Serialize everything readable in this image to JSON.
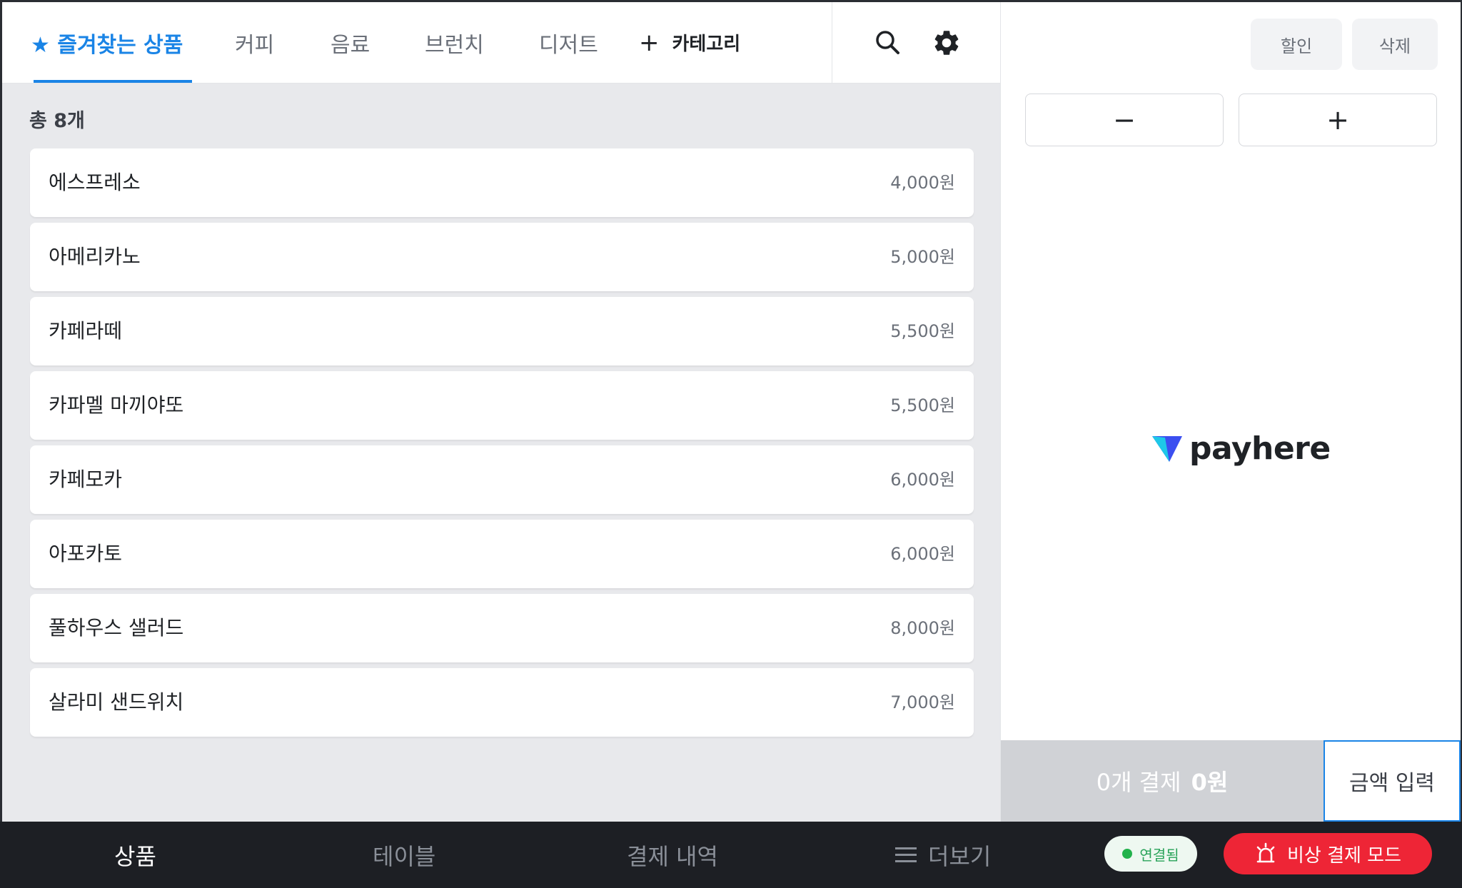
{
  "tabs": [
    {
      "label": "★ 즐겨찾는 상품",
      "active": true
    },
    {
      "label": "커피",
      "active": false
    },
    {
      "label": "음료",
      "active": false
    },
    {
      "label": "브런치",
      "active": false
    },
    {
      "label": "디저트",
      "active": false
    }
  ],
  "add_category": {
    "icon": "plus-icon",
    "label": "카테고리"
  },
  "toolbar_icons": [
    "search-icon",
    "gear-icon"
  ],
  "product_count": "총 8개",
  "products": [
    {
      "name": "에스프레소",
      "price": "4,000원"
    },
    {
      "name": "아메리카노",
      "price": "5,000원"
    },
    {
      "name": "카페라떼",
      "price": "5,500원"
    },
    {
      "name": "카파멜 마끼야또",
      "price": "5,500원"
    },
    {
      "name": "카페모카",
      "price": "6,000원"
    },
    {
      "name": "아포카토",
      "price": "6,000원"
    },
    {
      "name": "풀하우스 샐러드",
      "price": "8,000원"
    },
    {
      "name": "살라미 샌드위치",
      "price": "7,000원"
    }
  ],
  "order_panel": {
    "discount_label": "할인",
    "delete_label": "삭제",
    "minus_label": "−",
    "plus_label": "+",
    "logo_text": "payhere",
    "pay_count": "0개 결제",
    "pay_amount": "0원",
    "amount_input_label": "금액 입력"
  },
  "bottom_nav": {
    "items": [
      {
        "label": "상품",
        "active": true
      },
      {
        "label": "테이블",
        "active": false
      },
      {
        "label": "결제 내역",
        "active": false
      },
      {
        "label": "더보기",
        "active": false,
        "icon": "menu-icon"
      }
    ],
    "status_label": "연결됨",
    "emergency_label": "비상 결제 모드",
    "emergency_icon": "siren-icon"
  },
  "colors": {
    "accent": "#1a84e6",
    "emergency": "#ee2536",
    "connected": "#22b24c",
    "nav_bg": "#1d1f24"
  }
}
